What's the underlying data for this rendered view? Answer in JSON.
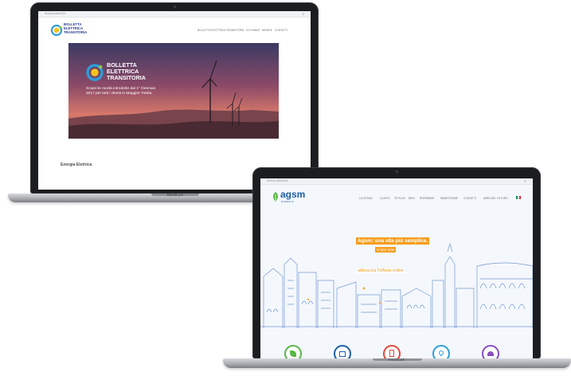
{
  "laptop1": {
    "topbar": {
      "text": "Servizio clienti 800",
      "search_icon": "search-icon"
    },
    "logo": {
      "lines": [
        "BOLLETTA",
        "ELETTRICA",
        "TRANSITORIA"
      ],
      "colors": {
        "ring": "#2e9bd6",
        "inner": "#f4c21c",
        "dot": "#8cc63f",
        "text": "#2a3b8f"
      }
    },
    "nav": [
      "BOLLETTA ELETTRICA TRANSITORIA",
      "CHI SIAMO",
      "NEWS ▾",
      "CONTATTI"
    ],
    "hero": {
      "title_lines": [
        "BOLLETTA",
        "ELETTRICA",
        "TRANSITORIA"
      ],
      "text_lines": [
        "Scopri le novità introdotte dal 1° Gennaio",
        "2017 per tutti i clienti in Maggior Tutela."
      ],
      "colors": {
        "sky_top": "#3b3a63",
        "sky_mid": "#a3535f",
        "sky_low": "#e08a6d",
        "ground": "#5e3838"
      }
    },
    "section_heading": "Energia Elettrica",
    "brand_label": "MacBook"
  },
  "laptop2": {
    "topbar": {
      "text": "Servizio clienti 800",
      "flag_icon": "flag-icon"
    },
    "logo": {
      "name": "agsm",
      "subtitle": "ENERGIA",
      "colors": {
        "name": "#1d5fa8",
        "leaf": "#58b947"
      }
    },
    "nav": [
      "LUCE/GAS",
      "CLIENTI",
      "TE PLUS",
      "BENI",
      "RISPARMIO",
      "SMART/HOME",
      "CONTATTI",
      "AREA DEL FUTURO"
    ],
    "hero": {
      "slogan": "Agsm: una vita più semplice.",
      "button1": "scopri tutte",
      "button2": "scopri tutte",
      "offer_text": "abbraccia l'offerta online",
      "colors": {
        "orange": "#f59e1f",
        "sketch": "#4b78c4",
        "bg": "#f4f8fd"
      }
    },
    "services": [
      {
        "icon": "leaf-icon",
        "color": "#58b947"
      },
      {
        "icon": "building-icon",
        "color": "#1d5fa8"
      },
      {
        "icon": "document-icon",
        "color": "#e4483b"
      },
      {
        "icon": "pin-icon",
        "color": "#2c9fd9"
      },
      {
        "icon": "people-icon",
        "color": "#8a4fc0"
      }
    ],
    "brand_label": "MacBook"
  }
}
